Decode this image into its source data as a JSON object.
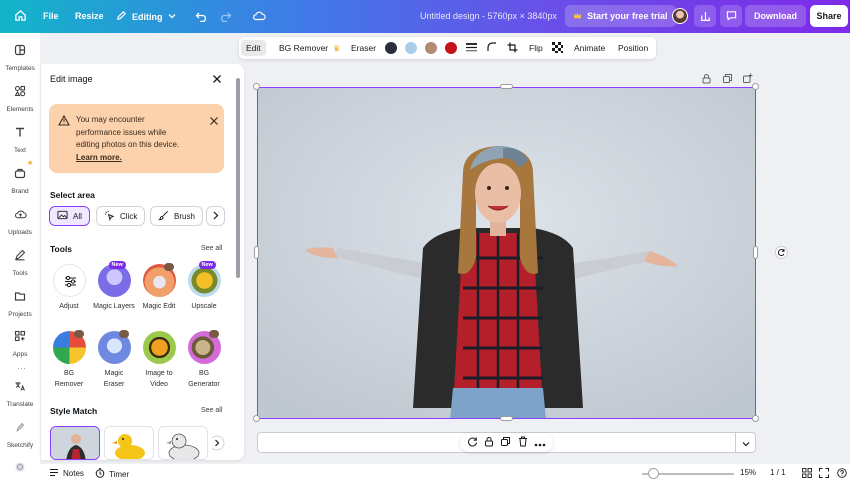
{
  "topbar": {
    "file": "File",
    "resize": "Resize",
    "editing": "Editing",
    "design_name": "Untitled design - 5760px × 3840px",
    "trial": "Start your free trial",
    "download": "Download",
    "share": "Share"
  },
  "rail": {
    "items": [
      "Templates",
      "Elements",
      "Text",
      "Brand",
      "Uploads",
      "Tools",
      "Projects",
      "Apps",
      "Translate",
      "Sketchify"
    ]
  },
  "panel": {
    "title": "Edit image",
    "warning": {
      "line1": "You may encounter",
      "line2": "performance issues while",
      "line3": "editing photos on this device.",
      "link": "Learn more."
    },
    "select_area": {
      "heading": "Select area",
      "chips": [
        "All",
        "Click",
        "Brush"
      ]
    },
    "tools": {
      "heading": "Tools",
      "see_all": "See all",
      "row1": [
        {
          "label": "Adjust",
          "badge": ""
        },
        {
          "label": "Magic Layers",
          "badge": "New"
        },
        {
          "label": "Magic Edit",
          "badge": ""
        },
        {
          "label": "Upscale",
          "badge": "New"
        }
      ],
      "row2": [
        {
          "label": "BG Remover"
        },
        {
          "label": "Magic Eraser"
        },
        {
          "label": "Image to Video"
        },
        {
          "label": "BG Generator"
        }
      ]
    },
    "style_match": {
      "heading": "Style Match",
      "see_all": "See all"
    }
  },
  "context_toolbar": {
    "edit": "Edit",
    "bg_remover": "BG Remover",
    "eraser": "Eraser",
    "swatches": [
      "#2b2d42",
      "#a9cfe8",
      "#b08b75",
      "#c4121f"
    ],
    "flip": "Flip",
    "animate": "Animate",
    "position": "Position"
  },
  "bottombar": {
    "notes": "Notes",
    "timer": "Timer",
    "zoom": "15%",
    "page": "1 / 1"
  }
}
